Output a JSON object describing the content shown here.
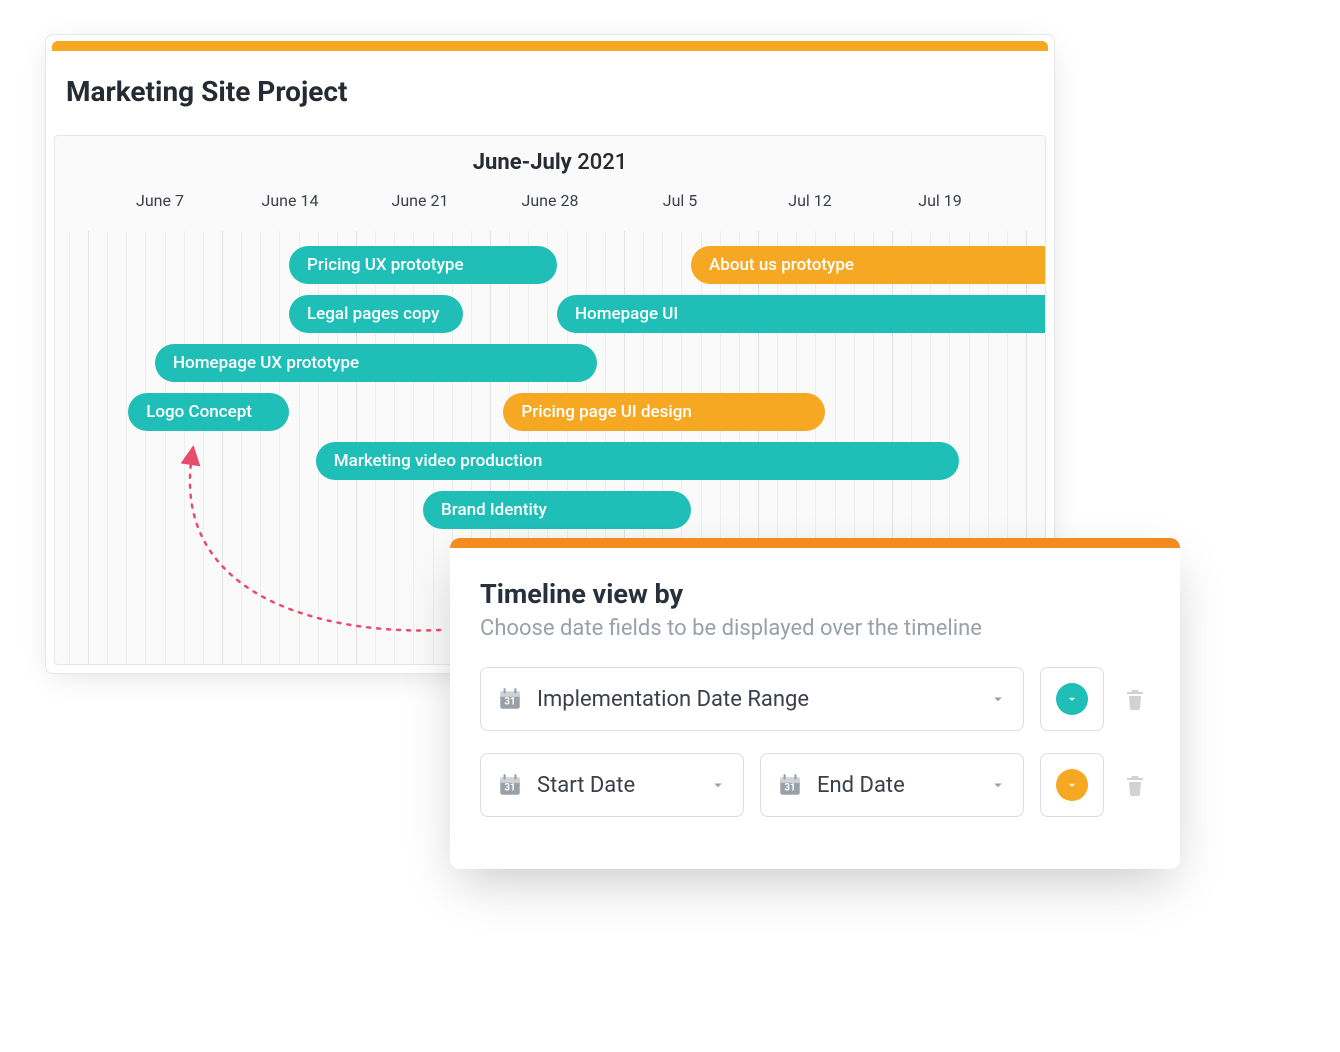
{
  "project": {
    "title": "Marketing Site Project",
    "range_label_bold": "June-July",
    "range_label_year": "2021",
    "date_headers": [
      "June 7",
      "June 14",
      "June 21",
      "June 28",
      "Jul 5",
      "Jul 12",
      "Jul 19"
    ]
  },
  "tasks": [
    {
      "label": "Pricing UX prototype",
      "row": 0,
      "start": 1,
      "span": 2,
      "color": "teal"
    },
    {
      "label": "About us prototype",
      "row": 0,
      "start": 4,
      "span": 3,
      "color": "orange"
    },
    {
      "label": "Legal pages copy",
      "row": 1,
      "start": 1,
      "span": 1.3,
      "color": "teal"
    },
    {
      "label": "Homepage UI",
      "row": 1,
      "start": 3,
      "span": 4,
      "color": "teal"
    },
    {
      "label": "Homepage UX prototype",
      "row": 2,
      "start": 0,
      "span": 3.3,
      "color": "teal"
    },
    {
      "label": "Logo Concept",
      "row": 3,
      "start": -0.2,
      "span": 1.2,
      "color": "teal"
    },
    {
      "label": "Pricing page UI design",
      "row": 3,
      "start": 2.6,
      "span": 2.4,
      "color": "orange"
    },
    {
      "label": "Marketing video production",
      "row": 4,
      "start": 1.2,
      "span": 4.8,
      "color": "teal"
    },
    {
      "label": "Brand Identity",
      "row": 5,
      "start": 2,
      "span": 2,
      "color": "teal"
    }
  ],
  "settings": {
    "title": "Timeline view by",
    "subtitle": "Choose date fields to be displayed over the timeline",
    "rows": [
      {
        "type": "single",
        "field": "Implementation Date Range",
        "color": "#1FBFB8"
      },
      {
        "type": "range",
        "start_field": "Start Date",
        "end_field": "End Date",
        "color": "#F7A823"
      }
    ]
  },
  "chart_data": {
    "type": "gantt",
    "title": "Marketing Site Project — June-July 2021",
    "x_axis": [
      "June 7",
      "June 14",
      "June 21",
      "June 28",
      "Jul 5",
      "Jul 12",
      "Jul 19"
    ],
    "unit": "week",
    "series": [
      {
        "name": "Pricing UX prototype",
        "start": "June 14",
        "end": "June 28",
        "color": "#1FBFB8"
      },
      {
        "name": "About us prototype",
        "start": "Jul 5",
        "end": "Jul 19+",
        "color": "#F7A823"
      },
      {
        "name": "Legal pages copy",
        "start": "June 14",
        "end": "June 23",
        "color": "#1FBFB8"
      },
      {
        "name": "Homepage UI",
        "start": "June 28",
        "end": "Jul 19+",
        "color": "#1FBFB8"
      },
      {
        "name": "Homepage UX prototype",
        "start": "June 7",
        "end": "June 30",
        "color": "#1FBFB8"
      },
      {
        "name": "Logo Concept",
        "start": "June 5",
        "end": "June 13",
        "color": "#1FBFB8"
      },
      {
        "name": "Pricing page UI design",
        "start": "June 25",
        "end": "Jul 12",
        "color": "#F7A823"
      },
      {
        "name": "Marketing video production",
        "start": "June 15",
        "end": "Jul 17",
        "color": "#1FBFB8"
      },
      {
        "name": "Brand Identity",
        "start": "June 21",
        "end": "Jul 5",
        "color": "#1FBFB8"
      }
    ]
  }
}
